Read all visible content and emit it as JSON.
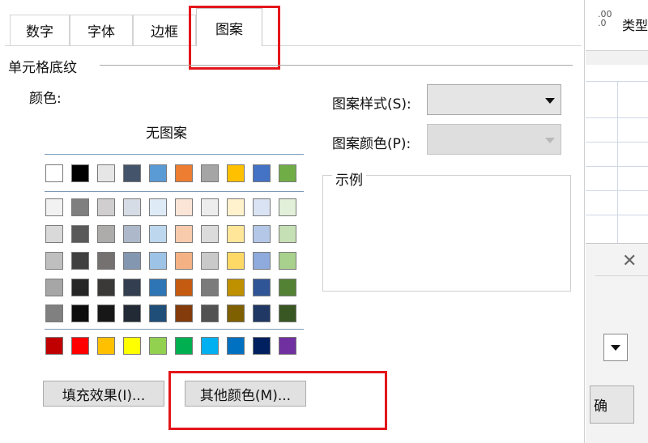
{
  "tabs": [
    {
      "label": "数字"
    },
    {
      "label": "字体"
    },
    {
      "label": "边框"
    },
    {
      "label": "图案"
    }
  ],
  "cell_shading": {
    "group_label": "单元格底纹",
    "color_label": "颜色:",
    "no_pattern_label": "无图案",
    "palette_rows": [
      [
        "#ffffff",
        "#000000",
        "#e7e6e6",
        "#44546a",
        "#5b9bd5",
        "#ed7d31",
        "#a5a5a5",
        "#ffc000",
        "#4472c4",
        "#70ad47"
      ],
      [
        "#f2f2f2",
        "#7f7f7f",
        "#d0cece",
        "#d6dce5",
        "#deebf7",
        "#fbe5d6",
        "#ededed",
        "#fff2cc",
        "#dae3f3",
        "#e2f0d9"
      ],
      [
        "#d9d9d9",
        "#595959",
        "#aeabab",
        "#adb9ca",
        "#bdd7ee",
        "#f8cbad",
        "#dbdbdb",
        "#ffe699",
        "#b4c7e7",
        "#c5e0b4"
      ],
      [
        "#bfbfbf",
        "#404040",
        "#757171",
        "#8497b0",
        "#9dc3e6",
        "#f4b183",
        "#c9c9c9",
        "#ffd966",
        "#8faadc",
        "#a9d18e"
      ],
      [
        "#a6a6a6",
        "#262626",
        "#3b3838",
        "#333f50",
        "#2e75b6",
        "#c55a11",
        "#7b7b7b",
        "#bf9000",
        "#2f5597",
        "#548235"
      ],
      [
        "#808080",
        "#0d0d0d",
        "#171717",
        "#222a35",
        "#1f4e79",
        "#843c0c",
        "#525252",
        "#7f6000",
        "#1f3864",
        "#385723"
      ],
      [
        "#c00000",
        "#ff0000",
        "#ffc000",
        "#ffff00",
        "#92d050",
        "#00b050",
        "#00b0f0",
        "#0070c0",
        "#002060",
        "#7030a0"
      ]
    ]
  },
  "pattern_style_label": "图案样式(S):",
  "pattern_color_label": "图案颜色(P):",
  "sample_label": "示例",
  "fill_effects_button": "填充效果(I)...",
  "more_colors_button": "其他颜色(M)...",
  "background": {
    "top_right_text": "类型",
    "close_glyph": "✕",
    "cut_button_text": "确"
  }
}
